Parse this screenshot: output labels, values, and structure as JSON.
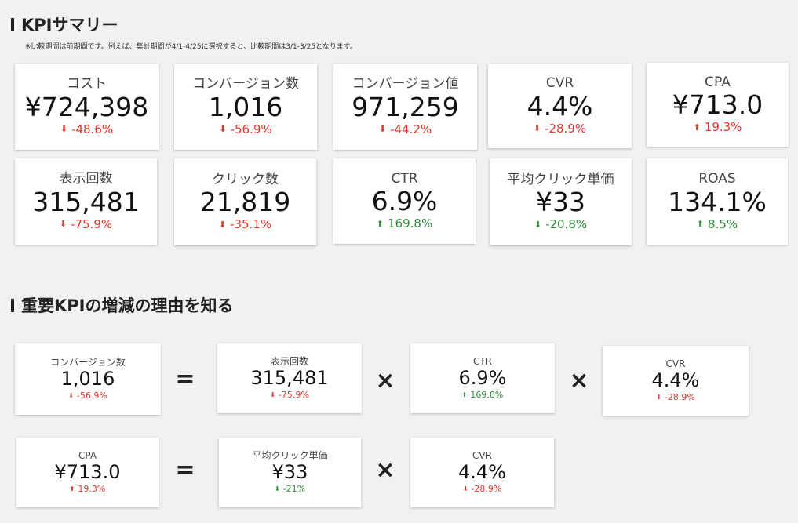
{
  "section1": {
    "title": "KPIサマリー",
    "note": "※比較期間は前期間です。例えば、集計期間が4/1-4/25に選択すると、比較期間は3/1-3/25となります。"
  },
  "kpis": [
    {
      "label": "コスト",
      "value": "¥724,398",
      "change": "-48.6%",
      "direction": "down",
      "tone": "bad"
    },
    {
      "label": "コンバージョン数",
      "value": "1,016",
      "change": "-56.9%",
      "direction": "down",
      "tone": "bad"
    },
    {
      "label": "コンバージョン値",
      "value": "971,259",
      "change": "-44.2%",
      "direction": "down",
      "tone": "bad"
    },
    {
      "label": "CVR",
      "value": "4.4%",
      "change": "-28.9%",
      "direction": "down",
      "tone": "bad"
    },
    {
      "label": "CPA",
      "value": "¥713.0",
      "change": "19.3%",
      "direction": "up",
      "tone": "bad"
    },
    {
      "label": "表示回数",
      "value": "315,481",
      "change": "-75.9%",
      "direction": "down",
      "tone": "bad"
    },
    {
      "label": "クリック数",
      "value": "21,819",
      "change": "-35.1%",
      "direction": "down",
      "tone": "bad"
    },
    {
      "label": "CTR",
      "value": "6.9%",
      "change": "169.8%",
      "direction": "up",
      "tone": "good"
    },
    {
      "label": "平均クリック単価",
      "value": "¥33",
      "change": "-20.8%",
      "direction": "down",
      "tone": "good"
    },
    {
      "label": "ROAS",
      "value": "134.1%",
      "change": "8.5%",
      "direction": "up",
      "tone": "good"
    }
  ],
  "section2": {
    "title": "重要KPIの増減の理由を知る"
  },
  "operators": {
    "equals": "=",
    "times": "×"
  },
  "formula1": [
    {
      "label": "コンバージョン数",
      "value": "1,016",
      "change": "-56.9%",
      "direction": "down",
      "tone": "bad"
    },
    {
      "label": "表示回数",
      "value": "315,481",
      "change": "-75.9%",
      "direction": "down",
      "tone": "bad"
    },
    {
      "label": "CTR",
      "value": "6.9%",
      "change": "169.8%",
      "direction": "up",
      "tone": "good"
    },
    {
      "label": "CVR",
      "value": "4.4%",
      "change": "-28.9%",
      "direction": "down",
      "tone": "bad"
    }
  ],
  "formula2": [
    {
      "label": "CPA",
      "value": "¥713.0",
      "change": "19.3%",
      "direction": "up",
      "tone": "bad"
    },
    {
      "label": "平均クリック単価",
      "value": "¥33",
      "change": "-21%",
      "direction": "down",
      "tone": "good"
    },
    {
      "label": "CVR",
      "value": "4.4%",
      "change": "-28.9%",
      "direction": "down",
      "tone": "bad"
    }
  ],
  "colors": {
    "bad": "#e0362c",
    "good": "#2f8a3a"
  }
}
